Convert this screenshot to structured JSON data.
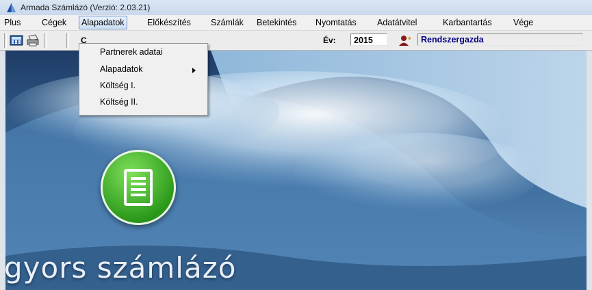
{
  "window": {
    "title": "Armada Számlázó (Verzió: 2.03.21)"
  },
  "menubar": {
    "items": [
      {
        "label": "Plus"
      },
      {
        "label": "Cégek"
      },
      {
        "label": "Alapadatok"
      },
      {
        "label": "Előkészítés"
      },
      {
        "label": "Számlák"
      },
      {
        "label": "Betekintés"
      },
      {
        "label": "Nyomtatás"
      },
      {
        "label": "Adatátvitel"
      },
      {
        "label": "Karbantartás"
      },
      {
        "label": "Vége"
      }
    ],
    "active": "Alapadatok"
  },
  "toolbar": {
    "c_label": "C",
    "ev_label": "Év:",
    "year": "2015",
    "user": "Rendszergazda"
  },
  "dropdown": {
    "items": [
      {
        "label": "Partnerek adatai"
      },
      {
        "label": "Alapadatok",
        "submenu": true
      },
      {
        "label": "Költség I."
      },
      {
        "label": "Költség II."
      }
    ]
  },
  "brand": {
    "text": "gyors számlázó"
  },
  "colors": {
    "accent": "#6b8fc6",
    "logo_green": "#2d9a1c",
    "user_text": "#000080"
  }
}
